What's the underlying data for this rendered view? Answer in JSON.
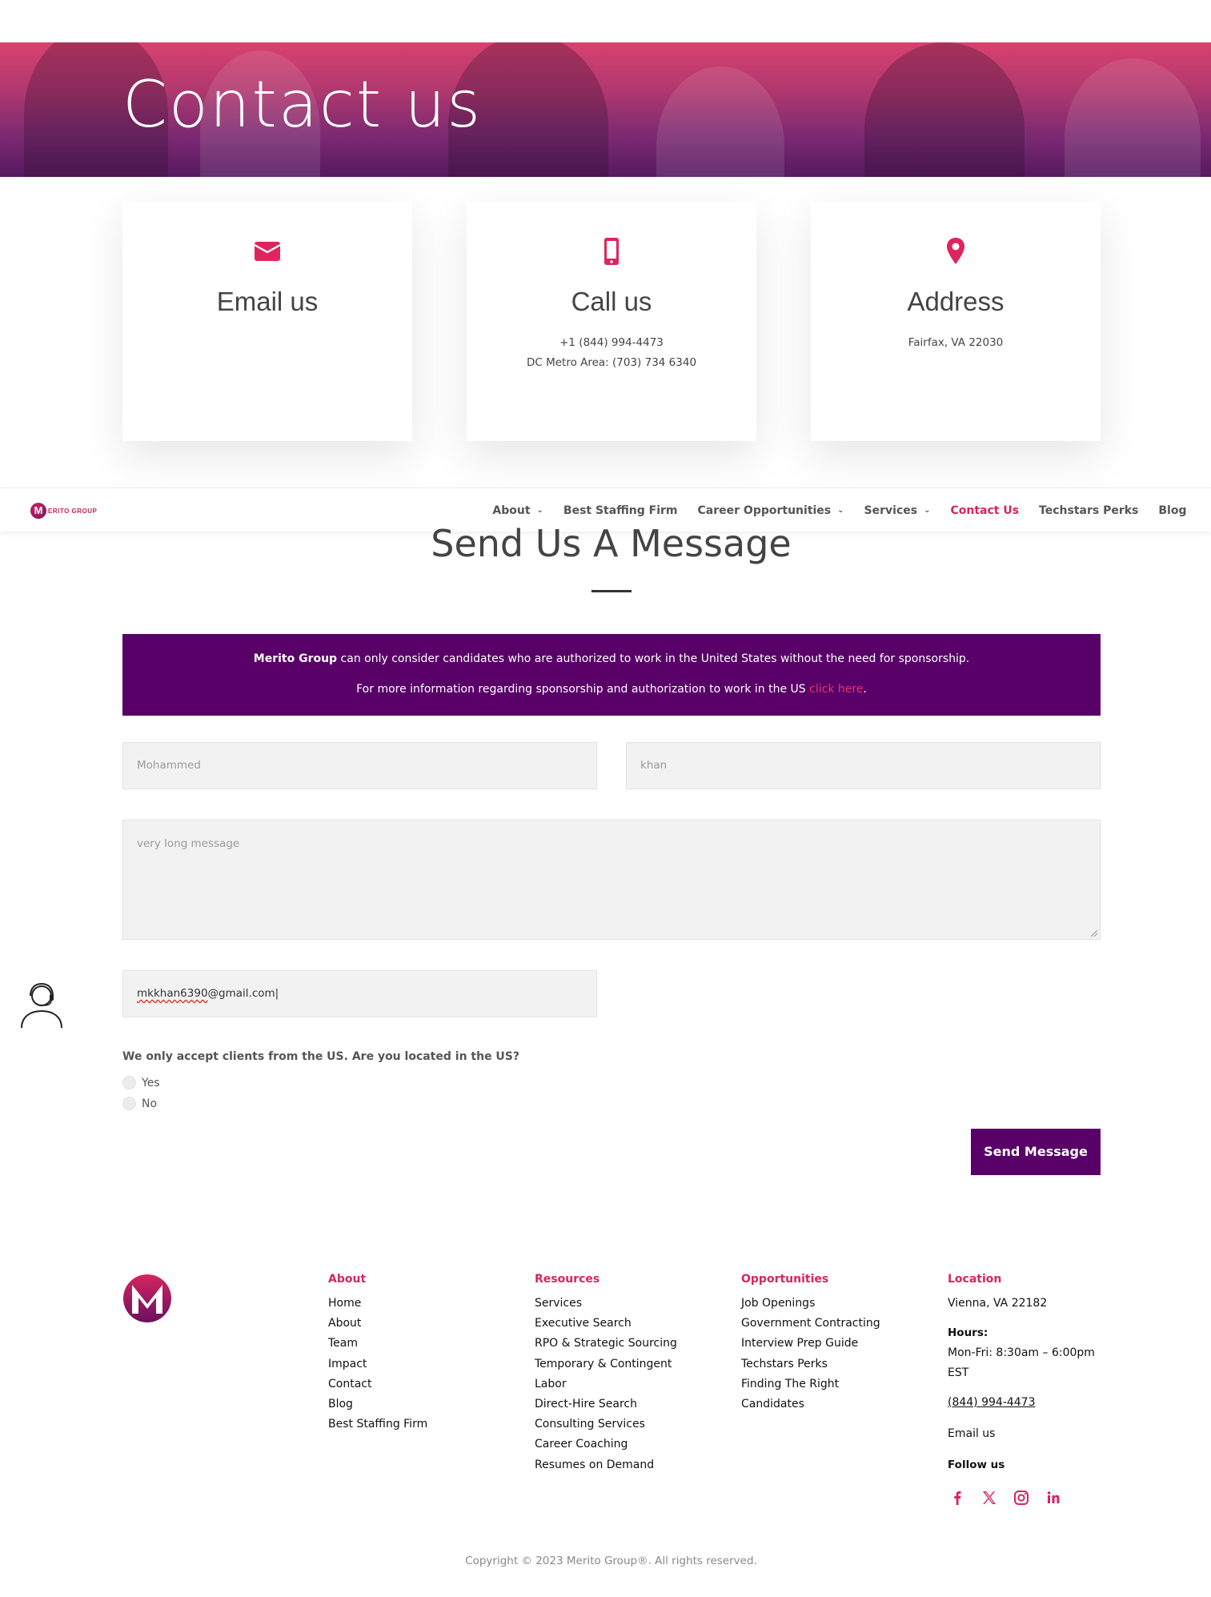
{
  "hero": {
    "title": "Contact us"
  },
  "cards": [
    {
      "icon": "envelope-icon",
      "title": "Email us",
      "lines": []
    },
    {
      "icon": "phone-icon",
      "title": "Call us",
      "lines": [
        "+1 (844) 994-4473",
        "DC Metro Area: (703) 734 6340"
      ]
    },
    {
      "icon": "location-pin-icon",
      "title": "Address",
      "lines": [
        "Fairfax, VA 22030"
      ]
    }
  ],
  "nav": {
    "logo_text": "ERITO GROUP",
    "logo_letter": "M",
    "items": [
      {
        "label": "About",
        "has_dropdown": true
      },
      {
        "label": "Best Staffing Firm",
        "has_dropdown": false
      },
      {
        "label": "Career Opportunities",
        "has_dropdown": true
      },
      {
        "label": "Services",
        "has_dropdown": true
      },
      {
        "label": "Contact Us",
        "has_dropdown": false,
        "active": true
      },
      {
        "label": "Techstars Perks",
        "has_dropdown": false
      },
      {
        "label": "Blog",
        "has_dropdown": false
      }
    ]
  },
  "message_section": {
    "title": "Send Us A Message",
    "notice": {
      "company": "Merito Group",
      "line1_rest": " can only consider candidates who are authorized to work in the United States without the need for sponsorship.",
      "line2": "For more information regarding sponsorship and authorization to work in the US ",
      "link": "click here",
      "line2_end": "."
    },
    "form": {
      "first_name_placeholder": "Mohammed",
      "last_name_placeholder": "khan",
      "message_placeholder": "very long message",
      "email_user": "mkkhan6390",
      "email_domain": "@gmail.com",
      "question": "We only accept clients from the US. Are you located in the US?",
      "options": [
        "Yes",
        "No"
      ],
      "submit_label": "Send Message"
    }
  },
  "footer": {
    "columns": [
      {
        "heading": "About",
        "links": [
          "Home",
          "About",
          "Team",
          "Impact",
          "Contact",
          "Blog",
          "Best Staffing Firm"
        ]
      },
      {
        "heading": "Resources",
        "links": [
          "Services",
          "Executive Search",
          "RPO & Strategic Sourcing",
          "Temporary & Contingent",
          "Labor",
          "Direct-Hire Search",
          "Consulting Services",
          "Career Coaching",
          "Resumes on Demand"
        ]
      },
      {
        "heading": "Opportunities",
        "links": [
          "Job Openings",
          "Government Contracting",
          "Interview Prep Guide",
          "Techstars Perks",
          "Finding The Right",
          "Candidates"
        ]
      }
    ],
    "location": {
      "heading": "Location",
      "address": "Vienna, VA 22182",
      "hours_label": "Hours:",
      "hours": "Mon-Fri: 8:30am – 6:00pm",
      "hours_tz": "EST",
      "phone": "(844) 994-4473",
      "email_label": "Email us",
      "follow_label": "Follow us",
      "social": [
        "facebook-icon",
        "x-icon",
        "instagram-icon",
        "linkedin-icon"
      ]
    },
    "copyright": "Copyright © 2023 Merito Group®. All rights reserved."
  },
  "colors": {
    "accent": "#d6245f",
    "purple": "#580068"
  }
}
